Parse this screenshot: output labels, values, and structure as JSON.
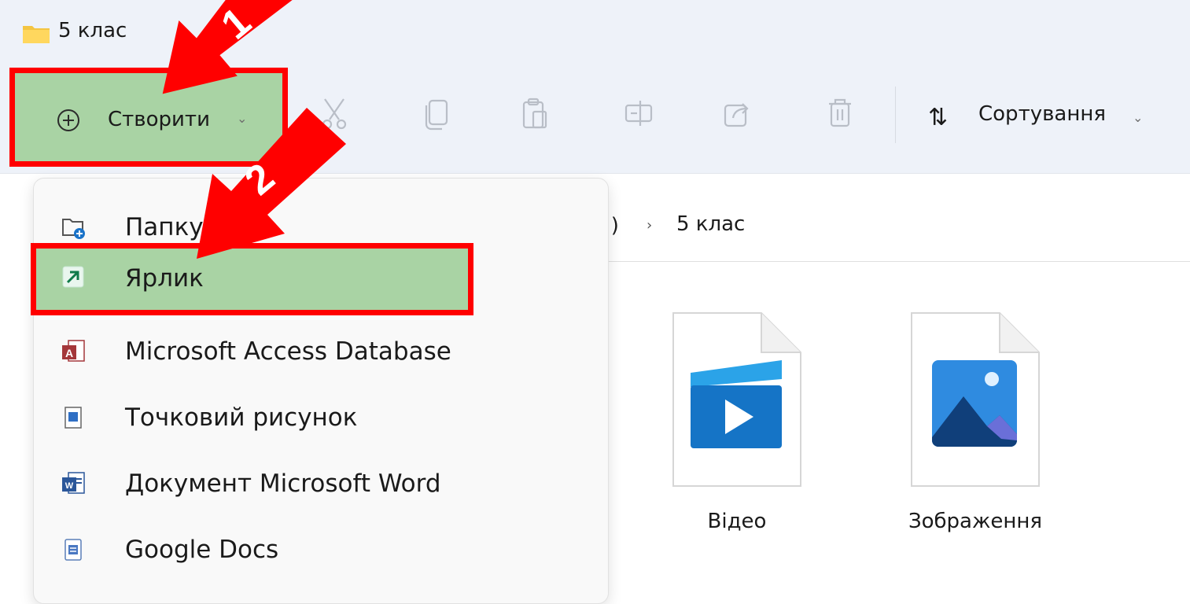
{
  "window": {
    "title": "5 клас"
  },
  "toolbar": {
    "create_label": "Створити",
    "sort_label": "Сортування",
    "icons": [
      "cut-icon",
      "copy-icon",
      "paste-icon",
      "rename-icon",
      "share-icon",
      "delete-icon"
    ]
  },
  "address": {
    "drive": "D:)",
    "current": "5 клас"
  },
  "menu": {
    "items": [
      {
        "label": "Папку",
        "icon": "new-folder-icon"
      },
      {
        "label": "Ярлик",
        "icon": "shortcut-icon"
      },
      {
        "label": "Microsoft Access Database",
        "icon": "access-icon"
      },
      {
        "label": "Точковий рисунок",
        "icon": "bitmap-icon"
      },
      {
        "label": "Документ Microsoft Word",
        "icon": "word-icon"
      },
      {
        "label": "Google Docs",
        "icon": "google-docs-icon"
      }
    ]
  },
  "files": [
    {
      "name": "Відео",
      "icon": "video-icon"
    },
    {
      "name": "Зображення",
      "icon": "image-icon"
    }
  ],
  "annotations": {
    "step1": "1",
    "step2": "2",
    "color": "#ff0000"
  },
  "colors": {
    "highlight_bg": "#a9d3a4",
    "highlight_border": "#ff0000",
    "toolbar_bg": "#eef2f9"
  }
}
